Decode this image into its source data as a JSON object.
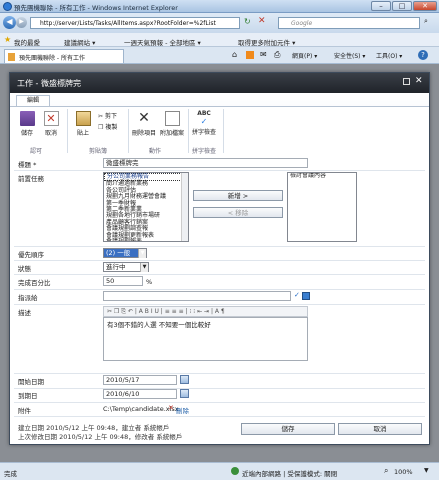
{
  "window": {
    "title": "預先團機聯除 - 所有工作 - Windows Internet Explorer"
  },
  "address": {
    "url": "http://server/Lists/Tasks/AllItems.aspx?RootFolder=%2fList",
    "search_placeholder": "Google"
  },
  "favorites": {
    "label": "我的最愛",
    "items": [
      "建議網站 ▾",
      "一週天氣預報 - 全部地區 ▾",
      "取得更多附加元件 ▾"
    ]
  },
  "tab": {
    "label": "預先團機聯除 - 所有工作"
  },
  "command_bar": {
    "items": [
      "網頁(P) ▾",
      "安全性(S) ▾",
      "工具(O) ▾"
    ]
  },
  "dialog": {
    "title": "工作 - 微盛標牌完",
    "ribbon": {
      "tab_label": "編輯",
      "buttons": {
        "save": "儲存",
        "cancel": "取消",
        "paste": "貼上",
        "cut": "剪下",
        "copy": "複製",
        "delete_item": "刪除項目",
        "attach_file": "附加檔案",
        "spelling": "拼字檢查"
      },
      "groups": [
        "認可",
        "剪貼簿",
        "動作",
        "拼字檢查"
      ]
    },
    "form": {
      "title_label": "標題 *",
      "title_value": "微盛標牌完",
      "predecessors_label": "前置任務",
      "predecessors_available": [
        "分公司業務報告",
        "簡介通過新業務",
        "各公司評估",
        "規劃九月財務運營會議",
        "第一季財報",
        "第二季新業業",
        "規劃各地行銷市場研",
        "產品顧客行銷案",
        "會議規劃調查報",
        "會議規劃更新報表",
        "會議規劃報表"
      ],
      "predecessors_selected": [
        "檢討會議內容"
      ],
      "add_button": "新增 >",
      "remove_button": "< 移除",
      "priority_label": "優先順序",
      "priority_value": "(2) 一般",
      "status_label": "狀態",
      "status_value": "進行中",
      "percent_label": "完成百分比",
      "percent_value": "50",
      "percent_unit": "%",
      "assigned_label": "指派給",
      "description_label": "描述",
      "description_value": "有3個不錯的人選 不知要一個比較好",
      "start_label": "開始日期",
      "start_value": "2010/5/17",
      "due_label": "到期日",
      "due_value": "2010/6/10",
      "attachments_label": "附件",
      "attachment_file": "C:\\Temp\\candidate.xlsx",
      "attachment_delete": "刪除",
      "created_line": "建立日期 2010/5/12 上午 09:48，建立者 系統帳戶",
      "modified_line": "上次修改日期 2010/5/12 上午 09:48，修改者 系統帳戶",
      "save_button": "儲存",
      "cancel_button": "取消"
    }
  },
  "status_bar": {
    "left": "完成",
    "zone": "近端內部網路 | 受保護模式: 關閉",
    "zoom": "100%"
  }
}
